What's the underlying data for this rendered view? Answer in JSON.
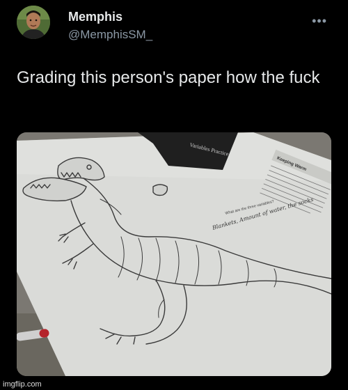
{
  "author": {
    "name": "Memphis",
    "handle": "@MemphisSM_"
  },
  "tweet": {
    "text": "Grading this person's paper how the fuck"
  },
  "menu": {
    "icon": "more-horizontal-icon",
    "glyph": "•••"
  },
  "media": {
    "description_icon": "photo-of-dinosaur-drawing-on-worksheet",
    "worksheet_header": "Variables Practice",
    "section_title": "Keeping Warm",
    "handwritten_answer": "Blankets, Amount of water, the socks",
    "printed_question": "What are the three variables?"
  },
  "watermark": "imgflip.com",
  "colors": {
    "background": "#000000",
    "text": "#e7e9ea",
    "muted": "#8b98a5"
  }
}
